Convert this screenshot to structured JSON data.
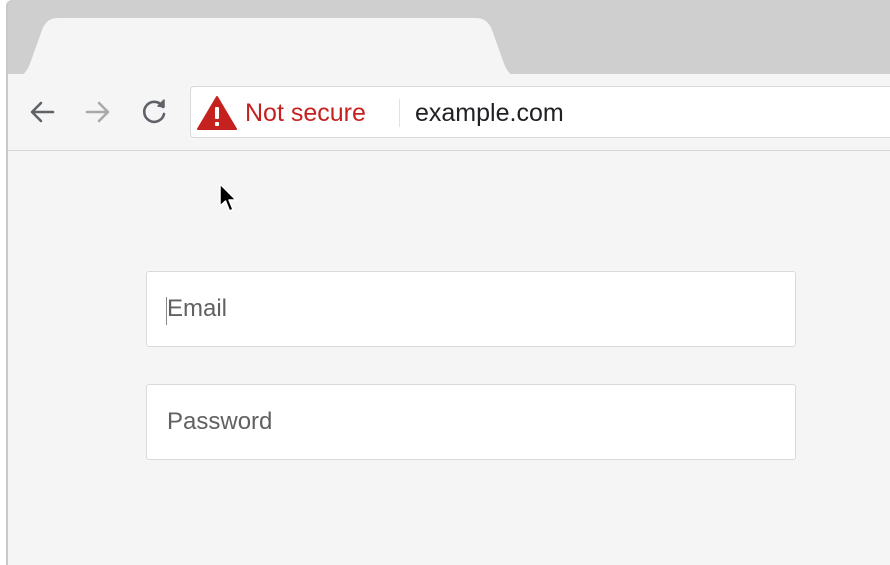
{
  "browser": {
    "security_label": "Not secure",
    "url": "example.com",
    "security_color": "#c5221f",
    "icons": {
      "back": "arrow-left-icon",
      "forward": "arrow-right-icon",
      "reload": "reload-icon",
      "security": "warning-triangle-icon",
      "pointer": "mouse-pointer-icon"
    }
  },
  "form": {
    "email_placeholder": "Email",
    "password_placeholder": "Password"
  }
}
